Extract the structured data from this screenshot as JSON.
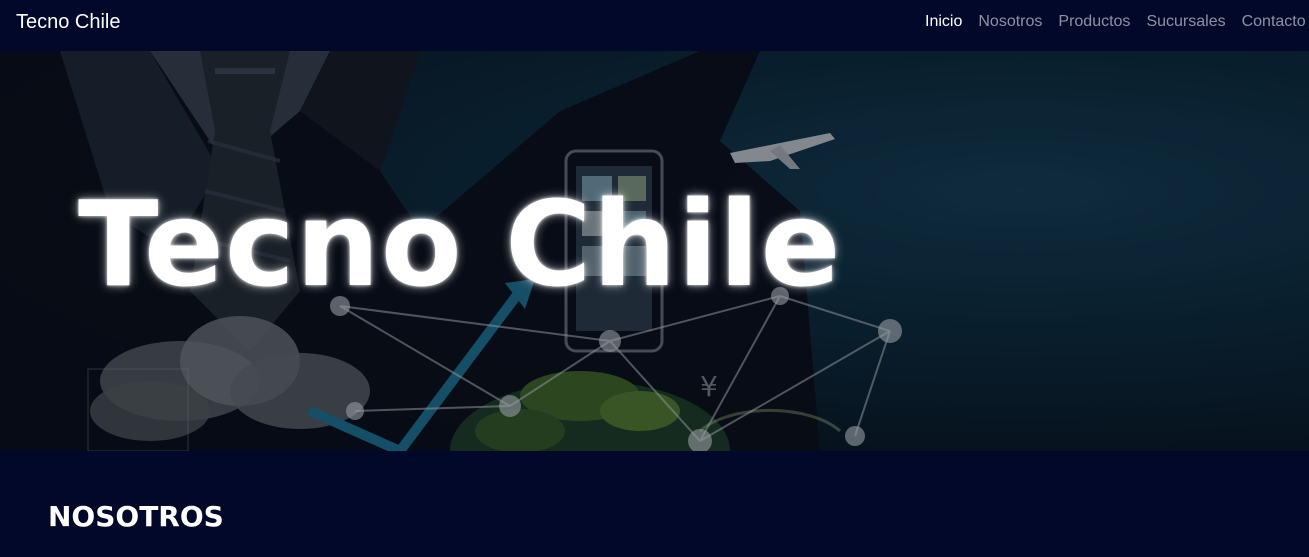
{
  "navbar": {
    "brand": "Tecno Chile",
    "links": [
      {
        "label": "Inicio",
        "active": true
      },
      {
        "label": "Nosotros",
        "active": false
      },
      {
        "label": "Productos",
        "active": false
      },
      {
        "label": "Sucursales",
        "active": false
      },
      {
        "label": "Contacto",
        "active": false
      }
    ]
  },
  "hero": {
    "title": "Tecno Chile",
    "background_image": "businessman-suit-technology-network"
  },
  "section": {
    "title": "NOSOTROS"
  },
  "colors": {
    "background": "#02082a",
    "text": "#ffffff",
    "nav_inactive": "rgba(255,255,255,0.55)"
  }
}
